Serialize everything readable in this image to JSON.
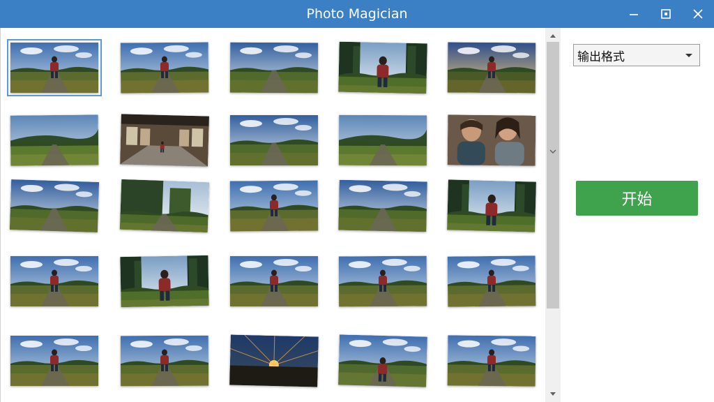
{
  "window": {
    "title": "Photo Magician",
    "controls": [
      "minimize",
      "maximize",
      "close"
    ]
  },
  "colors": {
    "titlebar": "#3b7fc4",
    "start_button": "#3fa34d",
    "selection": "#5a9ad8"
  },
  "sidebar": {
    "output_format_label": "输出格式",
    "start_label": "开始"
  },
  "gallery": {
    "selected_index": 0,
    "thumbnails": [
      {
        "scene": "person-field"
      },
      {
        "scene": "person-field"
      },
      {
        "scene": "field-path"
      },
      {
        "scene": "forest-person"
      },
      {
        "scene": "person-sunset"
      },
      {
        "scene": "road-hills"
      },
      {
        "scene": "building-hall"
      },
      {
        "scene": "field-path"
      },
      {
        "scene": "road-hills"
      },
      {
        "scene": "two-people"
      },
      {
        "scene": "field-path"
      },
      {
        "scene": "forest-path"
      },
      {
        "scene": "person-field"
      },
      {
        "scene": "field-path"
      },
      {
        "scene": "forest-person"
      },
      {
        "scene": "person-field"
      },
      {
        "scene": "forest-person"
      },
      {
        "scene": "person-field"
      },
      {
        "scene": "person-field"
      },
      {
        "scene": "person-field"
      },
      {
        "scene": "person-field"
      },
      {
        "scene": "person-field"
      },
      {
        "scene": "sunburst"
      },
      {
        "scene": "person-road"
      },
      {
        "scene": "person-field"
      }
    ]
  }
}
